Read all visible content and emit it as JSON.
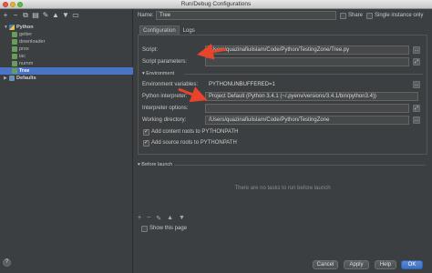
{
  "window": {
    "title": "Run/Debug Configurations"
  },
  "toolbar": {
    "icons": [
      "add-icon",
      "remove-icon",
      "copy-icon",
      "save-icon",
      "wrench-icon",
      "move-up-icon",
      "move-down-icon",
      "folder-icon"
    ]
  },
  "tree": {
    "python": "Python",
    "items": [
      "getter",
      "downloader",
      "prox",
      "iac",
      "numm"
    ],
    "selected": "Tree",
    "defaults": "Defaults"
  },
  "header": {
    "name_label": "Name:",
    "name_value": "Tree",
    "share_label": "Share",
    "single_label": "Single instance only"
  },
  "tabs": [
    "Configuration",
    "Logs"
  ],
  "config": {
    "script_label": "Script:",
    "script_value": "/Users/quazinafiulislam/Code/Python/TestingZone/Tree.py",
    "params_label": "Script parameters:",
    "params_value": "",
    "env_section": "▾ Environment",
    "envvars_label": "Environment variables:",
    "envvars_value": "PYTHONUNBUFFERED=1",
    "interp_label": "Python interpreter:",
    "interp_value": "Project Default (Python 3.4.1 (~/.pyenv/versions/3.4.1/bin/python3.4))",
    "interp_opts_label": "Interpreter options:",
    "interp_opts_value": "",
    "workdir_label": "Working directory:",
    "workdir_value": "/Users/quazinafiulislam/Code/Python/TestingZone",
    "add_content_label": "Add content roots to PYTHONPATH",
    "add_source_label": "Add source roots to PYTHONPATH"
  },
  "before_launch": {
    "header": "▾ Before launch",
    "empty": "There are no tasks to run before launch",
    "show_page_label": "Show this page"
  },
  "buttons": {
    "cancel": "Cancel",
    "apply": "Apply",
    "help": "Help",
    "ok": "OK",
    "question": "?"
  },
  "colors": {
    "background": "#3c3f41",
    "selection": "#4a75c7",
    "annotation_arrow": "#e8442b"
  }
}
